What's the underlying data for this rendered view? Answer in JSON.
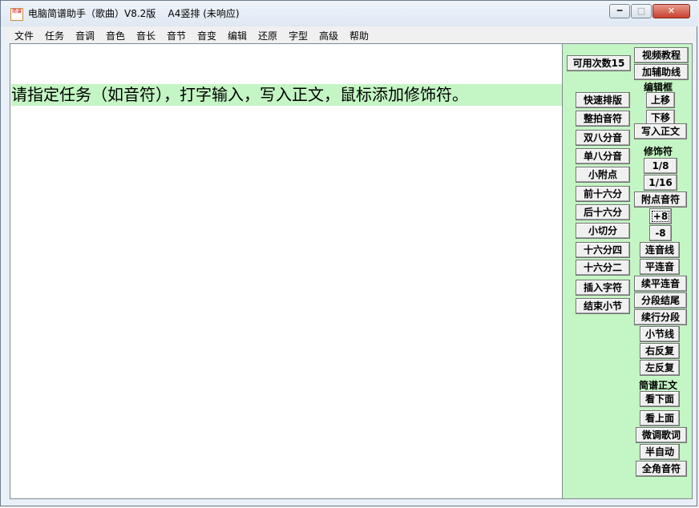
{
  "window": {
    "title": "电脑简谱助手（歌曲）V8.2版    A4竖排 (未响应)",
    "icon_text": "简谱",
    "controls": {
      "minimize": "━",
      "maximize": "□",
      "close": "✕"
    }
  },
  "menu": [
    "文件",
    "任务",
    "音调",
    "音色",
    "音长",
    "音节",
    "音变",
    "编辑",
    "还原",
    "字型",
    "高级",
    "帮助"
  ],
  "editor": {
    "prompt": "请指定任务（如音符），打字输入，写入正文，鼠标添加修饰符。"
  },
  "panel": {
    "uses_left": "可用次数15",
    "video_tutorial": "视频教程",
    "add_guides": "加辅助线",
    "edit_box_label": "编辑框",
    "move_up": "上移",
    "move_down": "下移",
    "write_body": "写入正文",
    "decor_label": "修饰符",
    "one_eighth": "1/8",
    "one_sixteenth": "1/16",
    "dotted_note": "附点音符",
    "plus8": "+8",
    "minus8": "-8",
    "slur": "连音线",
    "flat_slur": "平连音",
    "cont_flat_slur": "续平连音",
    "section_end": "分段结尾",
    "cont_section": "续行分段",
    "barline": "小节线",
    "right_repeat": "右反复",
    "left_repeat": "左反复",
    "jianpu_label": "简谱正文",
    "look_below": "看下面",
    "look_above": "看上面",
    "adjust_lyrics": "微调歌词",
    "half_auto": "半自动",
    "fullwidth_symbol": "全角音符",
    "quick_layout": "快速排版",
    "whole_beat": "整拍音符",
    "double_eighth": "双八分音",
    "single_eighth": "单八分音",
    "small_dot": "小附点",
    "front_sixteenth": "前十六分",
    "back_sixteenth": "后十六分",
    "small_cut": "小切分",
    "sixteenth_four": "十六分四",
    "sixteenth_two": "十六分二",
    "insert_char": "插入字符",
    "end_bar": "结束小节"
  }
}
